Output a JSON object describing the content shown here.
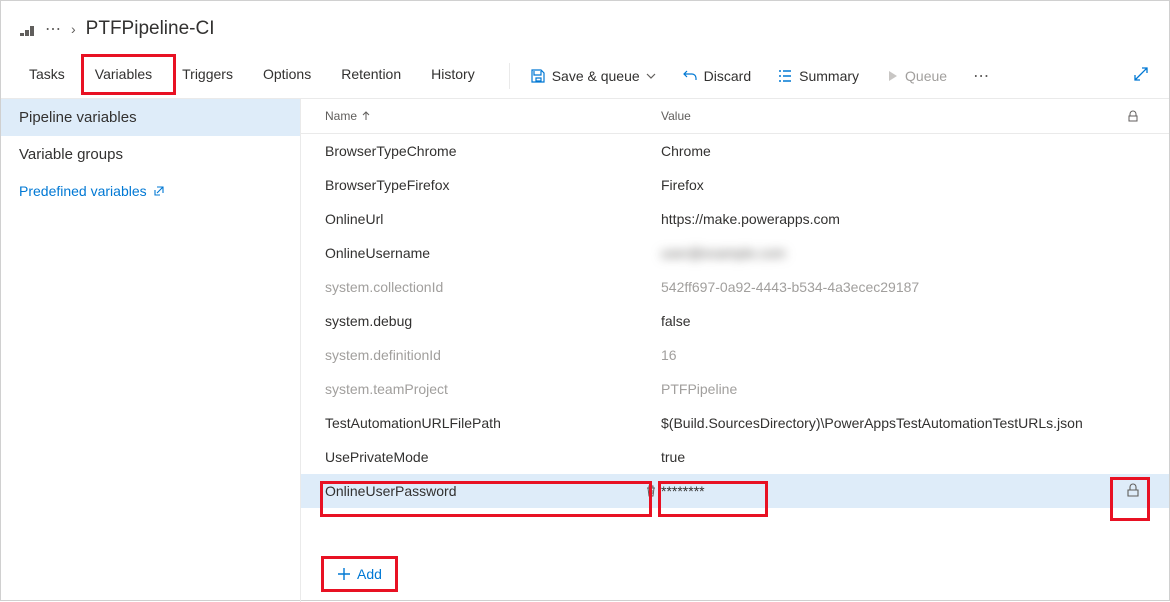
{
  "breadcrumb": {
    "ellipsis": "⋯",
    "separator": "›",
    "title": "PTFPipeline-CI"
  },
  "tabs": [
    {
      "label": "Tasks"
    },
    {
      "label": "Variables"
    },
    {
      "label": "Triggers"
    },
    {
      "label": "Options"
    },
    {
      "label": "Retention"
    },
    {
      "label": "History"
    }
  ],
  "commands": {
    "save": "Save & queue",
    "discard": "Discard",
    "summary": "Summary",
    "queue": "Queue"
  },
  "sidebar": {
    "pipeline_vars": "Pipeline variables",
    "variable_groups": "Variable groups",
    "predefined": "Predefined variables"
  },
  "columns": {
    "name": "Name",
    "value": "Value"
  },
  "rows": [
    {
      "name": "BrowserTypeChrome",
      "value": "Chrome",
      "system": false
    },
    {
      "name": "BrowserTypeFirefox",
      "value": "Firefox",
      "system": false
    },
    {
      "name": "OnlineUrl",
      "value": "https://make.powerapps.com",
      "system": false
    },
    {
      "name": "OnlineUsername",
      "value": "user@example.com",
      "system": false,
      "blurred": true
    },
    {
      "name": "system.collectionId",
      "value": "542ff697-0a92-4443-b534-4a3ecec29187",
      "system": true
    },
    {
      "name": "system.debug",
      "value": "false",
      "system": false
    },
    {
      "name": "system.definitionId",
      "value": "16",
      "system": true
    },
    {
      "name": "system.teamProject",
      "value": "PTFPipeline",
      "system": true
    },
    {
      "name": "TestAutomationURLFilePath",
      "value": "$(Build.SourcesDirectory)\\PowerAppsTestAutomationTestURLs.json",
      "system": false
    },
    {
      "name": "UsePrivateMode",
      "value": "true",
      "system": false
    },
    {
      "name": "OnlineUserPassword",
      "value": "********",
      "system": false,
      "selected": true,
      "deletable": true,
      "lock": true
    }
  ],
  "add_label": "Add"
}
